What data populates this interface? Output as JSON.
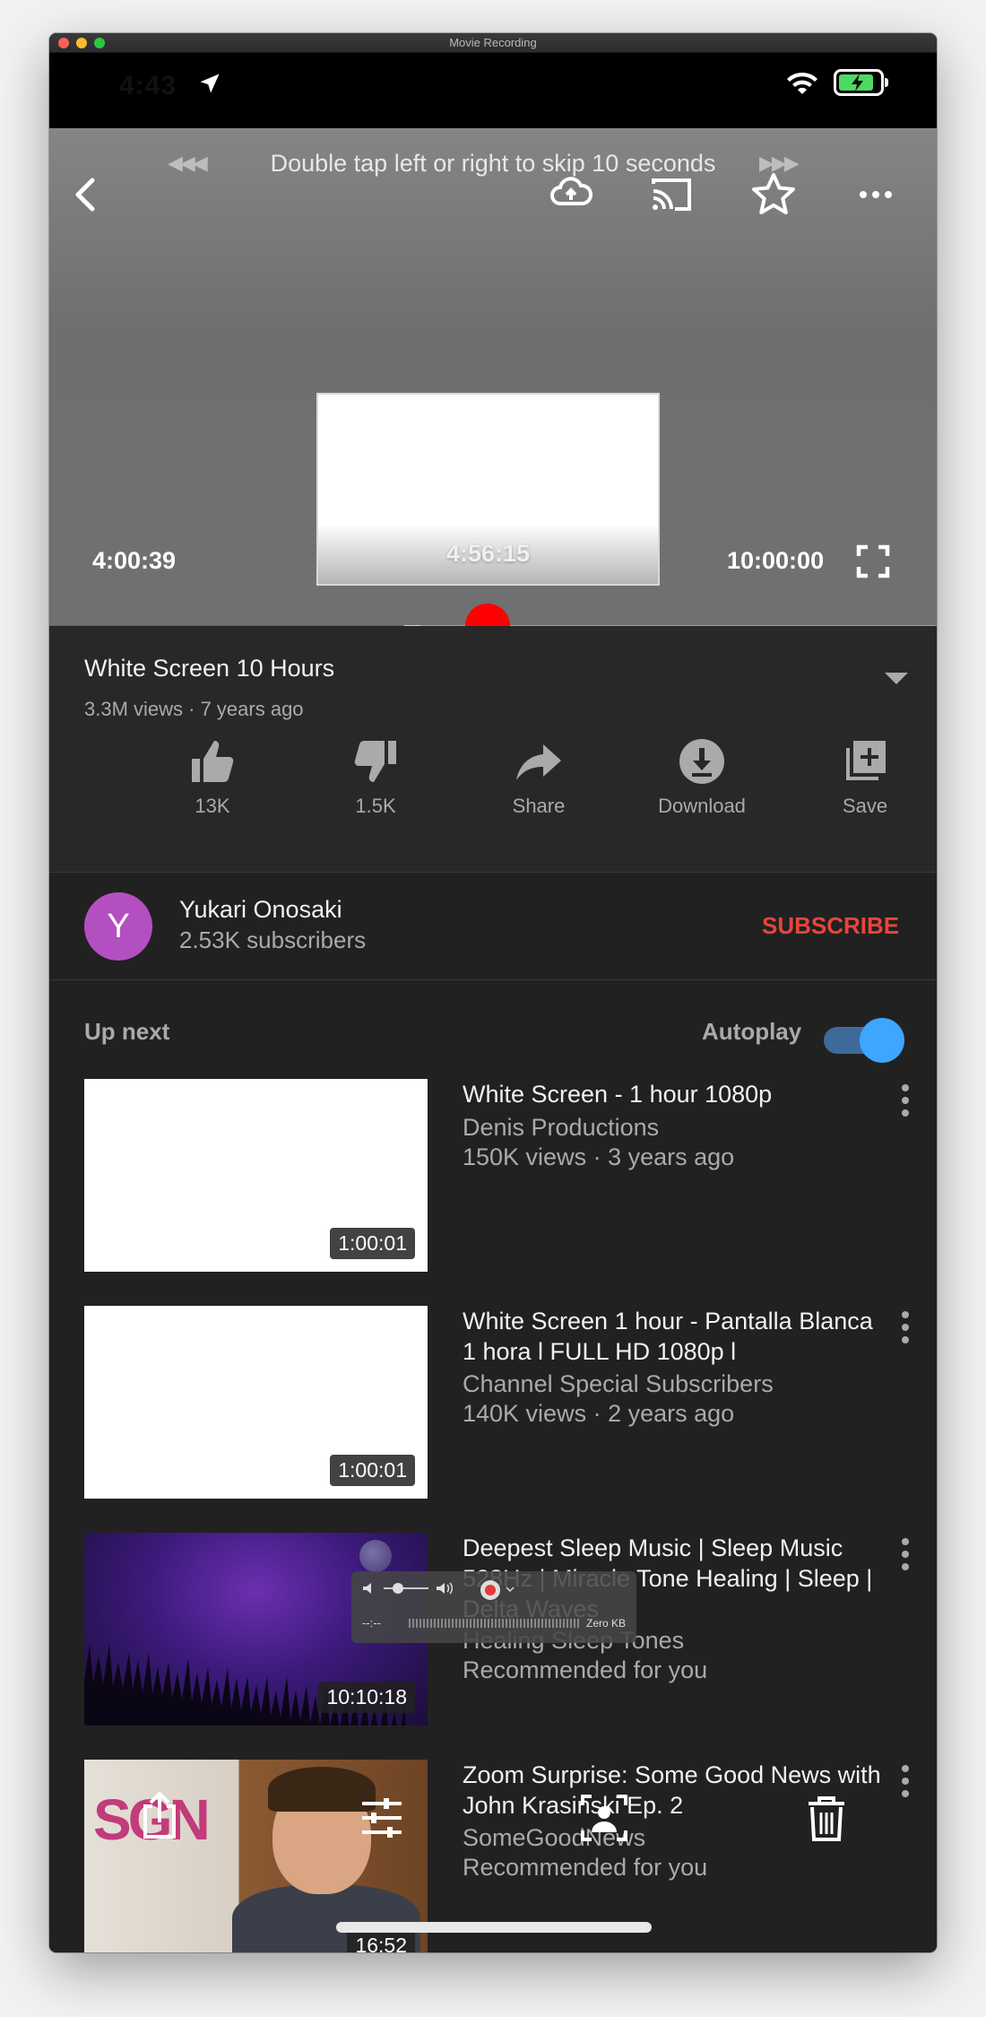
{
  "window": {
    "title": "Movie Recording"
  },
  "status_bar": {
    "time": "4:43"
  },
  "player": {
    "skip_hint": "Double tap left or right to skip 10 seconds",
    "preview_time": "4:56:15",
    "current_time": "4:00:39",
    "duration": "10:00:00",
    "played_fraction": 0.4,
    "buffered_fraction": 0.418,
    "thumb_fraction": 0.494
  },
  "video": {
    "title": "White Screen 10 Hours",
    "meta": "3.3M views · 7 years ago",
    "actions": [
      {
        "label": "13K"
      },
      {
        "label": "1.5K"
      },
      {
        "label": "Share"
      },
      {
        "label": "Download"
      },
      {
        "label": "Save"
      }
    ]
  },
  "channel": {
    "initial": "Y",
    "name": "Yukari Onosaki",
    "subscribers": "2.53K subscribers",
    "subscribe_label": "SUBSCRIBE"
  },
  "up_next": {
    "label": "Up next",
    "autoplay_label": "Autoplay",
    "autoplay_on": true,
    "items": [
      {
        "title": "White Screen - 1 hour 1080p",
        "channel": "Denis Productions",
        "meta": "150K views · 3 years ago",
        "duration": "1:00:01"
      },
      {
        "title": "White Screen 1 hour - Pantalla Blanca 1 hora l FULL HD 1080p l",
        "channel": "Channel Special Subscribers",
        "meta": "140K views · 2 years ago",
        "duration": "1:00:01"
      },
      {
        "title": "Deepest Sleep Music | Sleep Music 528Hz | Miracle Tone Healing | Sleep | Delta Waves",
        "channel": "Healing Sleep Tones",
        "meta": "Recommended for you",
        "duration": "10:10:18"
      },
      {
        "title": "Zoom Surprise: Some Good News with John Krasinski Ep. 2",
        "channel": "SomeGoodNews",
        "meta": "Recommended for you",
        "duration": "16:52",
        "thumb_text": "SGN"
      }
    ]
  },
  "recorder": {
    "time": "--:--",
    "size": "Zero KB"
  },
  "colors": {
    "accent_red": "#e52d27",
    "subscribe_red": "#e8453c",
    "toggle_blue": "#3ea6ff",
    "avatar_purple": "#b44fc1"
  }
}
